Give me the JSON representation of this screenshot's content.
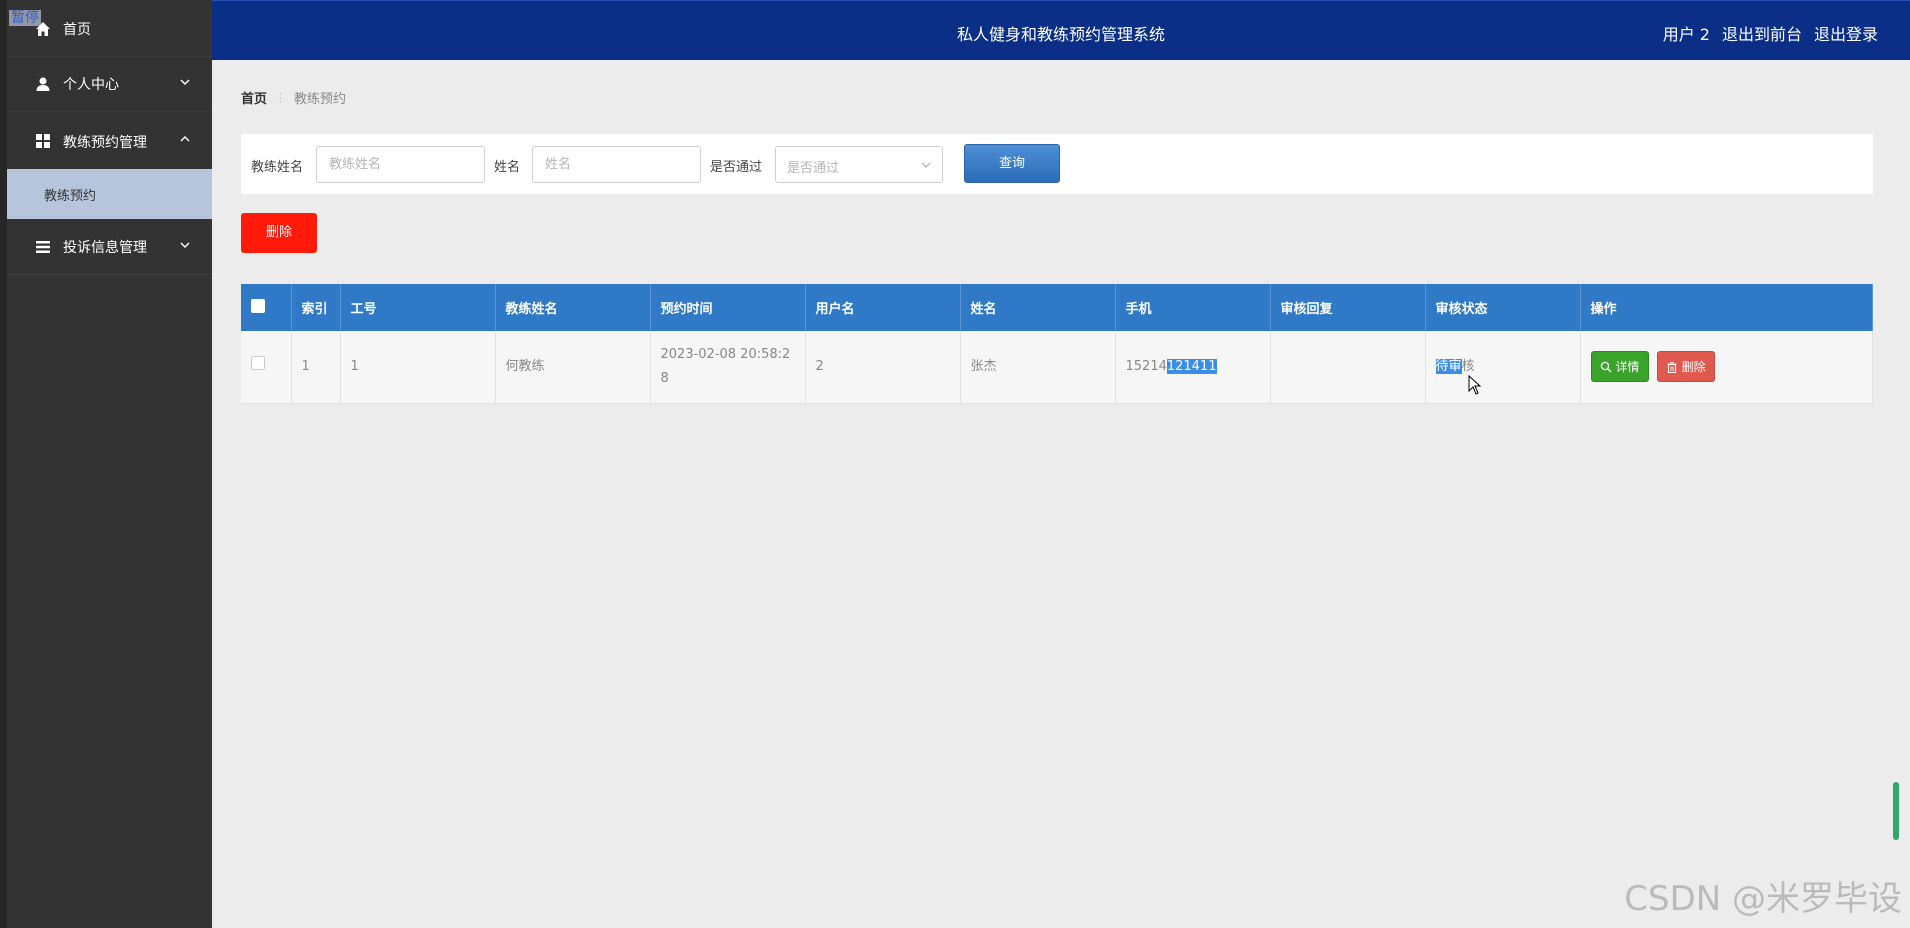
{
  "overlay_badge": "暂停",
  "sidebar": {
    "items": [
      {
        "label": "首页",
        "icon": "home-icon"
      },
      {
        "label": "个人中心",
        "icon": "user-icon"
      },
      {
        "label": "教练预约管理",
        "icon": "grid-icon"
      },
      {
        "label": "教练预约",
        "icon": ""
      },
      {
        "label": "投诉信息管理",
        "icon": "list-icon"
      }
    ]
  },
  "header": {
    "title": "私人健身和教练预约管理系统",
    "user": "用户 2",
    "back_to_front": "退出到前台",
    "logout": "退出登录"
  },
  "breadcrumb": {
    "home": "首页",
    "current": "教练预约"
  },
  "search": {
    "coach_name_label": "教练姓名",
    "coach_name_placeholder": "教练姓名",
    "name_label": "姓名",
    "name_placeholder": "姓名",
    "approved_label": "是否通过",
    "approved_placeholder": "是否通过",
    "query_button": "查询"
  },
  "actions": {
    "delete_button": "删除"
  },
  "table": {
    "headers": [
      "索引",
      "工号",
      "教练姓名",
      "预约时间",
      "用户名",
      "姓名",
      "手机",
      "审核回复",
      "审核状态",
      "操作"
    ],
    "rows": [
      {
        "index": "1",
        "job_no": "1",
        "coach_name": "何教练",
        "booking_time": "2023-02-08 20:58:28",
        "username": "2",
        "name": "张杰",
        "phone_a": "15214",
        "phone_b": "121411",
        "reply": "",
        "status_a": "待审",
        "status_b": "核",
        "detail_button": "详情",
        "delete_button": "删除"
      }
    ]
  },
  "watermark": "CSDN @米罗毕设",
  "colors": {
    "sidebar_bg": "#333333",
    "header_bg": "#0b2f87",
    "table_header_bg": "#2f79c7",
    "query_button": "#3a7cc8",
    "delete_button": "#ff1a0a",
    "detail_button": "#3aa32a",
    "row_delete_button": "#e0584e"
  }
}
